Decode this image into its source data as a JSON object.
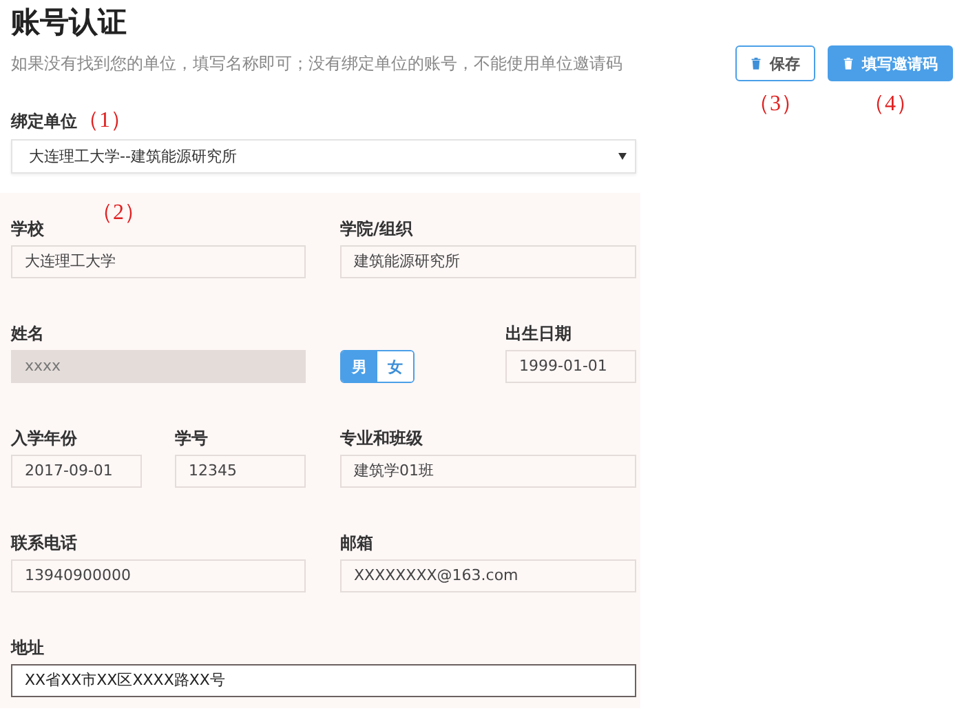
{
  "title": "账号认证",
  "description": "如果没有找到您的单位，填写名称即可；没有绑定单位的账号，不能使用单位邀请码",
  "bind_unit": {
    "label": "绑定单位",
    "annotation": "（1）",
    "value": "大连理工大学--建筑能源研究所"
  },
  "buttons": [
    {
      "label": "保存",
      "kind": "outline",
      "annotation": "（3）"
    },
    {
      "label": "填写邀请码",
      "kind": "primary",
      "annotation": "（4）"
    }
  ],
  "profile": {
    "annotation": "（2）",
    "fields": [
      {
        "kind": "input",
        "label": "学校",
        "value": "大连理工大学",
        "disabled": false,
        "focused": false
      },
      {
        "kind": "input",
        "label": "学院/组织",
        "value": "建筑能源研究所",
        "disabled": false,
        "focused": false
      },
      {
        "kind": "input",
        "label": "姓名",
        "value": "xxxx",
        "disabled": true,
        "focused": false
      },
      {
        "kind": "toggle",
        "options": [
          {
            "label": "男",
            "selected": true
          },
          {
            "label": "女",
            "selected": false
          }
        ]
      },
      {
        "kind": "input",
        "label": "出生日期",
        "value": "1999-01-01",
        "disabled": false,
        "focused": false
      },
      {
        "kind": "input",
        "label": "入学年份",
        "value": "2017-09-01",
        "disabled": false,
        "focused": false
      },
      {
        "kind": "input",
        "label": "学号",
        "value": "12345",
        "disabled": false,
        "focused": false
      },
      {
        "kind": "input",
        "label": "专业和班级",
        "value": "建筑学01班",
        "disabled": false,
        "focused": false
      },
      {
        "kind": "input",
        "label": "联系电话",
        "value": "13940900000",
        "disabled": false,
        "focused": false
      },
      {
        "kind": "input",
        "label": "邮箱",
        "value": "XXXXXXXX@163.com",
        "disabled": false,
        "focused": false
      },
      {
        "kind": "input",
        "label": "地址",
        "value": "XX省XX市XX区XXXX路XX号",
        "disabled": false,
        "focused": true
      }
    ]
  }
}
